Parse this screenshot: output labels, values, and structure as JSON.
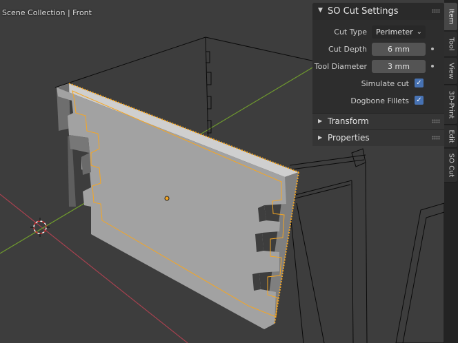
{
  "viewport": {
    "label": "Scene Collection | Front"
  },
  "panel": {
    "title": "SO  Cut Settings",
    "fields": [
      {
        "label": "Cut Type",
        "value": "Perimeter",
        "kind": "dropdown"
      },
      {
        "label": "Cut Depth",
        "value": "6 mm",
        "kind": "number"
      },
      {
        "label": "Tool Diameter",
        "value": "3 mm",
        "kind": "number"
      }
    ],
    "checkboxes": [
      {
        "label": "Simulate cut",
        "checked": true
      },
      {
        "label": "Dogbone Fillets",
        "checked": true
      }
    ],
    "subpanels": [
      "Transform",
      "Properties"
    ]
  },
  "tabs": [
    "Item",
    "Tool",
    "View",
    "3D-Print",
    "Edit",
    "SO Cut"
  ],
  "colors": {
    "accent": "#4772b3",
    "selection_outline": "#f5a623",
    "x_axis": "#a8414f",
    "y_axis": "#6f9a2e"
  }
}
